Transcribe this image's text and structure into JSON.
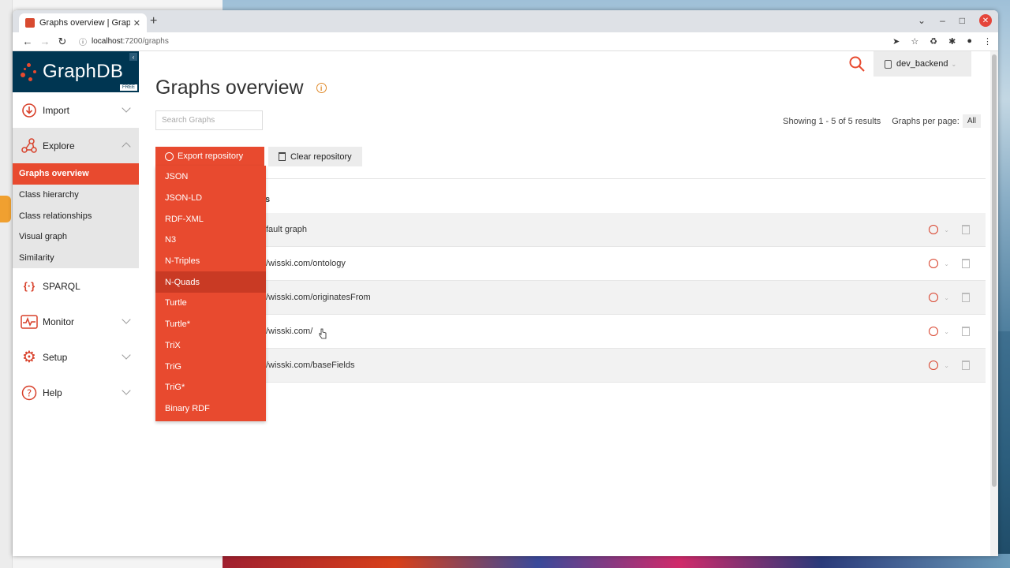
{
  "browser": {
    "tab_title": "Graphs overview | GraphDB",
    "new_tab": "+",
    "url_host": "localhost",
    "url_path": ":7200/graphs"
  },
  "sidebar": {
    "logo": "GraphDB",
    "edition": "FREE",
    "menu": {
      "import": "Import",
      "explore": "Explore",
      "sparql": "SPARQL",
      "monitor": "Monitor",
      "setup": "Setup",
      "help": "Help"
    },
    "explore_items": [
      {
        "label": "Graphs overview"
      },
      {
        "label": "Class hierarchy"
      },
      {
        "label": "Class relationships"
      },
      {
        "label": "Visual graph"
      },
      {
        "label": "Similarity"
      }
    ]
  },
  "header": {
    "repository": "dev_backend"
  },
  "page": {
    "title": "Graphs overview",
    "search_placeholder": "Search Graphs",
    "showing": "Showing 1 - 5 of 5 results",
    "per_page_label": "Graphs per page:",
    "per_page_value": "All",
    "export_label": "Export repository",
    "clear_label": "Clear repository",
    "column_head_partial": "s"
  },
  "export_formats": [
    "JSON",
    "JSON-LD",
    "RDF-XML",
    "N3",
    "N-Triples",
    "N-Quads",
    "Turtle",
    "Turtle*",
    "TriX",
    "TriG",
    "TriG*",
    "Binary RDF"
  ],
  "graphs": [
    {
      "uri_visible": "fault graph"
    },
    {
      "uri_visible": "/wisski.com/ontology"
    },
    {
      "uri_visible": "/wisski.com/originatesFrom"
    },
    {
      "uri_visible": "/wisski.com/"
    },
    {
      "uri_visible": "/wisski.com/baseFields"
    }
  ],
  "colors": {
    "accent": "#e84a2f",
    "logo_bg": "#003652"
  }
}
